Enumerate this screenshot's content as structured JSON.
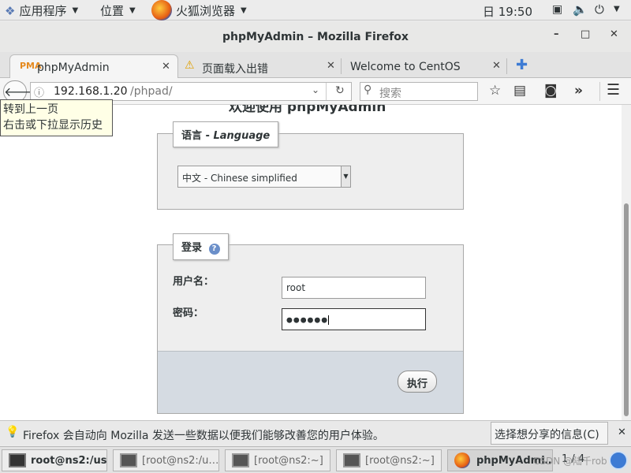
{
  "topbar": {
    "applications": "应用程序",
    "places": "位置",
    "browser": "火狐浏览器",
    "clock": "日 19:50"
  },
  "window": {
    "title": "phpMyAdmin – Mozilla Firefox",
    "minimize": "–",
    "maximize": "□",
    "close": "✕"
  },
  "tabs": [
    {
      "label": "phpMyAdmin",
      "icon": "phpmyadmin-icon"
    },
    {
      "label": "页面载入出错",
      "icon": "warning-icon"
    },
    {
      "label": "Welcome to CentOS",
      "icon": ""
    }
  ],
  "nav": {
    "url_host": "192.168.1.20",
    "url_path": "/phpad/",
    "search_placeholder": "搜索"
  },
  "tooltip": {
    "line1": "转到上一页",
    "line2": "右击或下拉显示历史"
  },
  "page": {
    "heading_fragment": "欢迎使用 phpMyAdmin",
    "language_legend_cn": "语言 - ",
    "language_legend_en": "Language",
    "language_selected": "中文 - Chinese simplified",
    "login_legend": "登录",
    "username_label": "用户名：",
    "username_value": "root",
    "password_label": "密码：",
    "password_value": "●●●●●●",
    "go_button": "执行"
  },
  "notification": {
    "text": "Firefox 会自动向 Mozilla 发送一些数据以便我们能够改善您的用户体验。",
    "button": "选择想分享的信息(C)"
  },
  "taskbar": {
    "items": [
      {
        "label": "root@ns2:/us…"
      },
      {
        "label": "[root@ns2:/u…"
      },
      {
        "label": "[root@ns2:~]"
      },
      {
        "label": "[root@ns2:~]"
      },
      {
        "label": "phpMyAdmi…"
      }
    ],
    "workspace": "1 / 4",
    "watermark": "CSDN @陆千rob"
  },
  "colors": {
    "accent": "#3d7bd4",
    "fieldset_bg": "#eeeeee",
    "login_footer_bg": "#d5dbe2"
  }
}
